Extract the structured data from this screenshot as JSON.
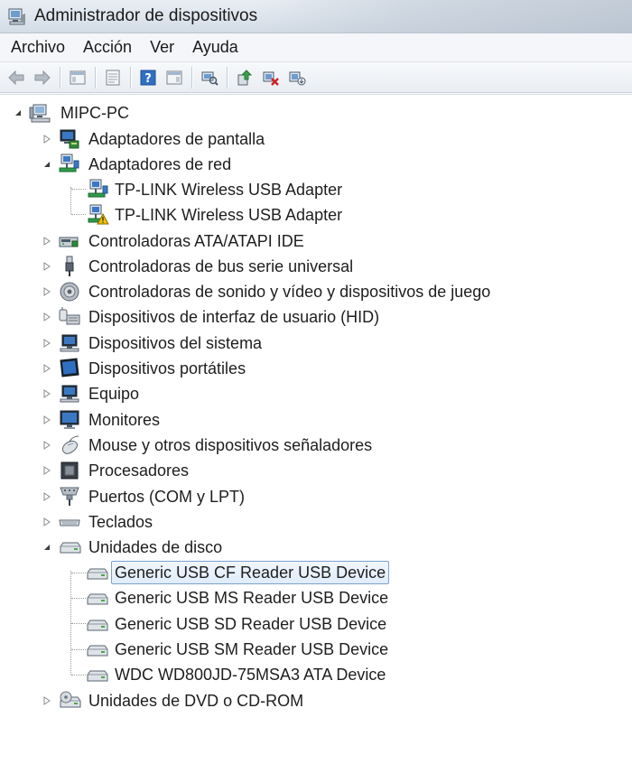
{
  "window": {
    "title": "Administrador de dispositivos"
  },
  "menu": [
    "Archivo",
    "Acción",
    "Ver",
    "Ayuda"
  ],
  "toolbar": [
    "back-icon",
    "forward-icon",
    "up-icon",
    "properties-icon",
    "help-icon",
    "show-hide-icon",
    "scan-hardware-icon",
    "update-driver-icon",
    "uninstall-icon",
    "disable-icon"
  ],
  "tree": {
    "root": "MIPC-PC",
    "nodes": [
      {
        "label": "Adaptadores de pantalla",
        "icon": "display-adapter-icon",
        "expanded": false
      },
      {
        "label": "Adaptadores de red",
        "icon": "network-adapter-icon",
        "expanded": true
      },
      {
        "label": "TP-LINK Wireless USB Adapter",
        "icon": "network-adapter-icon",
        "child": true
      },
      {
        "label": "TP-LINK Wireless USB Adapter",
        "icon": "network-warning-icon",
        "child": true,
        "warning": true
      },
      {
        "label": "Controladoras ATA/ATAPI IDE",
        "icon": "ide-controller-icon",
        "expanded": false
      },
      {
        "label": "Controladoras de bus serie universal",
        "icon": "usb-icon",
        "expanded": false
      },
      {
        "label": "Controladoras de sonido y vídeo y dispositivos de juego",
        "icon": "sound-icon",
        "expanded": false
      },
      {
        "label": "Dispositivos de interfaz de usuario (HID)",
        "icon": "hid-icon",
        "expanded": false
      },
      {
        "label": "Dispositivos del sistema",
        "icon": "system-device-icon",
        "expanded": false
      },
      {
        "label": "Dispositivos portátiles",
        "icon": "portable-device-icon",
        "expanded": false
      },
      {
        "label": "Equipo",
        "icon": "computer-icon",
        "expanded": false
      },
      {
        "label": "Monitores",
        "icon": "monitor-icon",
        "expanded": false
      },
      {
        "label": "Mouse y otros dispositivos señaladores",
        "icon": "mouse-icon",
        "expanded": false
      },
      {
        "label": "Procesadores",
        "icon": "processor-icon",
        "expanded": false
      },
      {
        "label": "Puertos (COM y LPT)",
        "icon": "port-icon",
        "expanded": false
      },
      {
        "label": "Teclados",
        "icon": "keyboard-icon",
        "expanded": false
      },
      {
        "label": "Unidades de disco",
        "icon": "disk-drive-icon",
        "expanded": true
      },
      {
        "label": "Generic USB CF Reader USB Device",
        "icon": "disk-drive-icon",
        "child": true,
        "selected": true
      },
      {
        "label": "Generic USB MS Reader USB Device",
        "icon": "disk-drive-icon",
        "child": true
      },
      {
        "label": "Generic USB SD Reader USB Device",
        "icon": "disk-drive-icon",
        "child": true
      },
      {
        "label": "Generic USB SM Reader USB Device",
        "icon": "disk-drive-icon",
        "child": true
      },
      {
        "label": "WDC WD800JD-75MSA3 ATA Device",
        "icon": "disk-drive-icon",
        "child": true
      },
      {
        "label": "Unidades de DVD o CD-ROM",
        "icon": "dvd-icon",
        "expanded": false
      }
    ]
  },
  "colors": {
    "selection_border": "#7da2ce",
    "selection_bg": "#e0ecfb",
    "warning": "#f2c200"
  }
}
